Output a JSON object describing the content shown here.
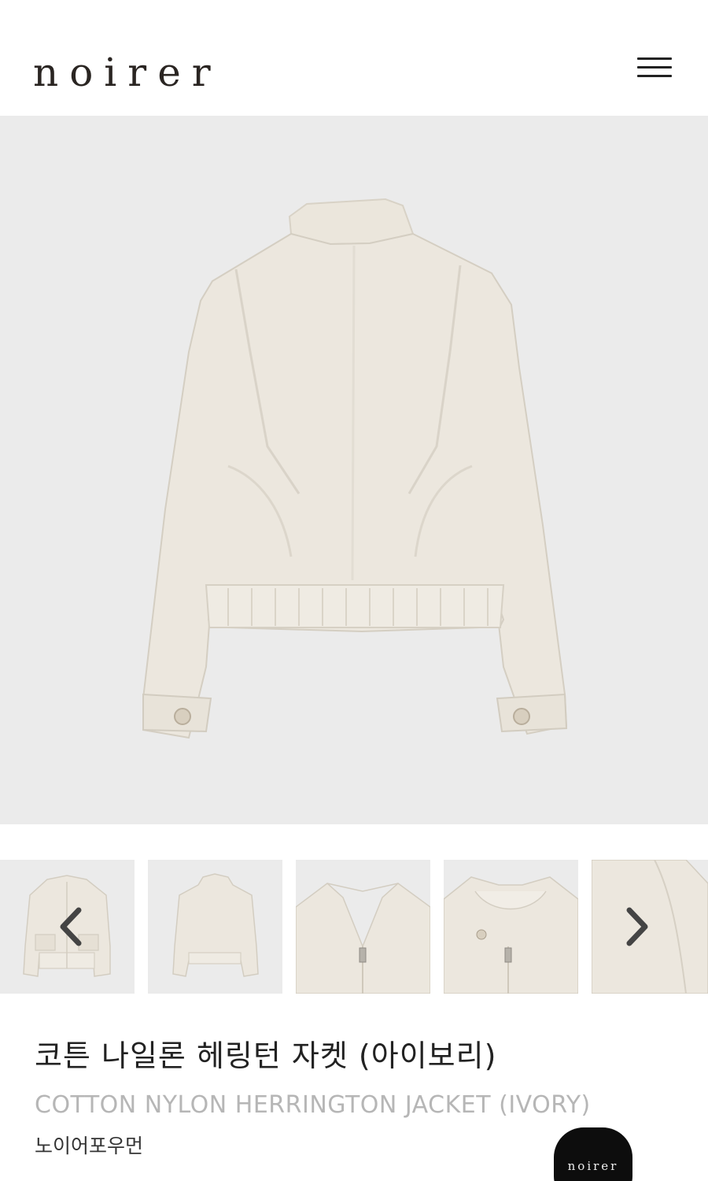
{
  "header": {
    "logo": "noirer",
    "menu_icon": "hamburger-menu-icon"
  },
  "hero": {
    "image": "ivory-jacket-back-view"
  },
  "thumbnails": [
    {
      "image": "jacket-front-view"
    },
    {
      "image": "jacket-back-view"
    },
    {
      "image": "collar-zipper-detail"
    },
    {
      "image": "collar-button-detail"
    },
    {
      "image": "shoulder-seam-detail"
    }
  ],
  "carousel": {
    "prev_icon": "chevron-left-icon",
    "next_icon": "chevron-right-icon"
  },
  "product": {
    "title_ko": "코튼 나일론 헤링턴 자켓 (아이보리)",
    "title_en": "COTTON NYLON HERRINGTON JACKET (IVORY)",
    "brand": "노이어포우먼"
  },
  "floating_badge": {
    "label": "noirer"
  },
  "colors": {
    "background": "#ffffff",
    "image_bg": "#ebebeb",
    "jacket": "#ece7de",
    "text_primary": "#222222",
    "text_muted": "#b6b6b6",
    "badge_bg": "#0d0d0d"
  }
}
